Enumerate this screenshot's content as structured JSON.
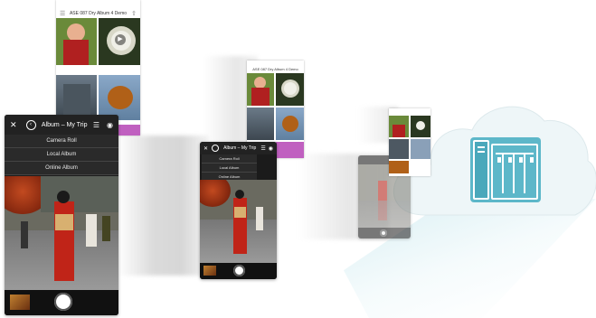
{
  "large_phone": {
    "album_title": "Album – My Trip",
    "menu": [
      "Camera Roll",
      "Local Album",
      "Online Album"
    ]
  },
  "mid_phone": {
    "album_title": "Album – My Trip",
    "menu": [
      "Camera Roll",
      "Local Album",
      "Online Album"
    ]
  },
  "top_sheet": {
    "header": "ASE 087 Dry Album 4 Demo"
  },
  "mid_sheet": {
    "header": "ASE 087 Dry Album 4 Demo"
  },
  "colors": {
    "cloud": "#eef6f8",
    "nas_teal": "#5db7c9",
    "beam": "#d2ecf1",
    "phone_dark": "#1b1b1b"
  },
  "icons": [
    "close-icon",
    "back-icon",
    "grid-icon",
    "camera-icon",
    "play-icon",
    "nas-device-icon"
  ]
}
